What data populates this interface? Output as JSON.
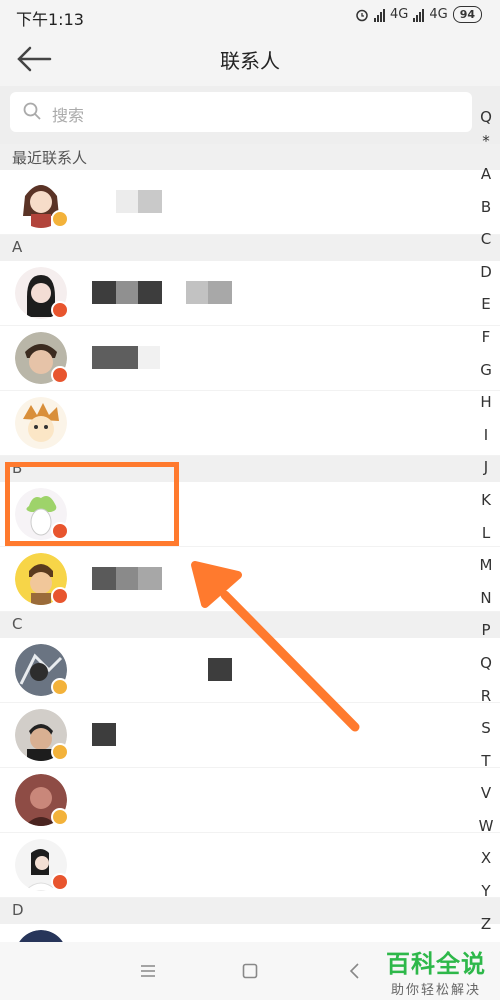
{
  "status": {
    "time": "下午1:13",
    "net1": "4G",
    "net2": "4G",
    "battery": "94"
  },
  "nav": {
    "title": "联系人"
  },
  "search": {
    "placeholder": "搜索"
  },
  "sections": [
    {
      "label": "最近联系人"
    },
    {
      "label": "A"
    },
    {
      "label": "B"
    },
    {
      "label": "C"
    },
    {
      "label": "D"
    }
  ],
  "alphabet": [
    "Q",
    "*",
    "A",
    "B",
    "C",
    "D",
    "E",
    "F",
    "G",
    "H",
    "I",
    "J",
    "K",
    "L",
    "M",
    "N",
    "P",
    "Q",
    "R",
    "S",
    "T",
    "V",
    "W",
    "X",
    "Y",
    "Z"
  ],
  "watermark": {
    "title": "百科全说",
    "subtitle": "助你轻松解决"
  },
  "colors": {
    "accent": "#ff7a2e",
    "badge": "#f3b23a",
    "watermark": "#2eb84a"
  }
}
